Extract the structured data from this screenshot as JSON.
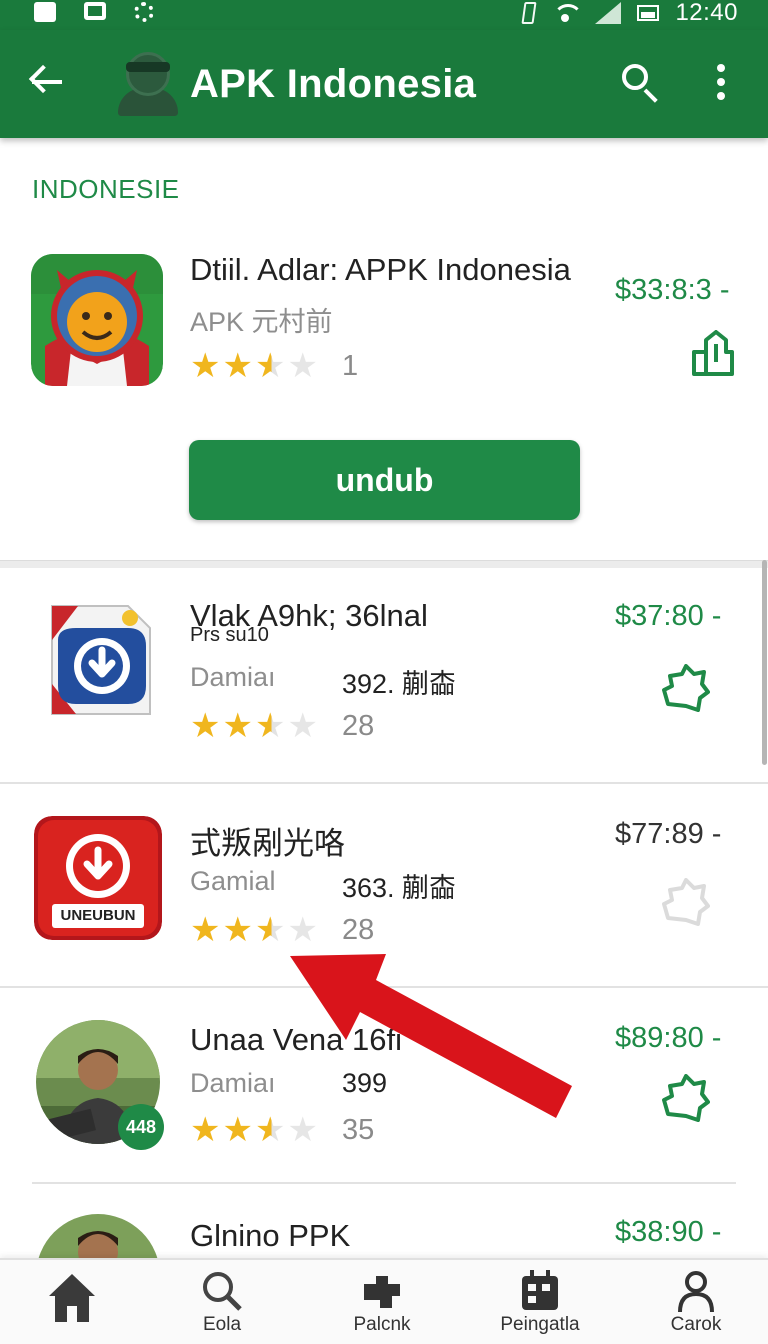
{
  "status_bar": {
    "time": "12:40"
  },
  "app_bar": {
    "title": "APK Indonesia"
  },
  "section": {
    "label": "INDONESIE"
  },
  "featured": {
    "name": "Dtiil. Adlar: APPK Indonesia",
    "subtitle": "APK 元村前",
    "rating_count": "1",
    "price": "$33:8:3 -",
    "download_label": "undub",
    "rating": 2.5
  },
  "items": [
    {
      "name": "Vlak A9hk; 36lnal",
      "name_overlay": "Prs su10",
      "category": "Damiaı",
      "size": "392. 蒯楍",
      "rating_count": "28",
      "price": "$37:80 -",
      "rating": 2.5
    },
    {
      "name": "式叛剐光咯",
      "category": "Gamial",
      "size": "363. 蒯楍",
      "rating_count": "28",
      "price": "$77:89 -",
      "icon_text": "UNEUBUN",
      "rating": 2.5
    },
    {
      "name": "Unaa Vena 16fi",
      "category": "Damiaı",
      "size": "399",
      "rating_count": "35",
      "price": "$89:80 -",
      "badge": "448",
      "rating": 2.5
    },
    {
      "name": "Glnino PPK",
      "price": "$38:90 -"
    }
  ],
  "bottom_nav": [
    {
      "label": "",
      "icon": "home-icon"
    },
    {
      "label": "Eola",
      "icon": "search-icon"
    },
    {
      "label": "Palcnk",
      "icon": "puzzle-icon"
    },
    {
      "label": "Peingatla",
      "icon": "calendar-icon"
    },
    {
      "label": "Carok",
      "icon": "person-icon"
    }
  ],
  "colors": {
    "primary": "#1a7a3c",
    "accent": "#1f8a47",
    "star": "#f0b61e",
    "arrow": "#d9141b"
  }
}
